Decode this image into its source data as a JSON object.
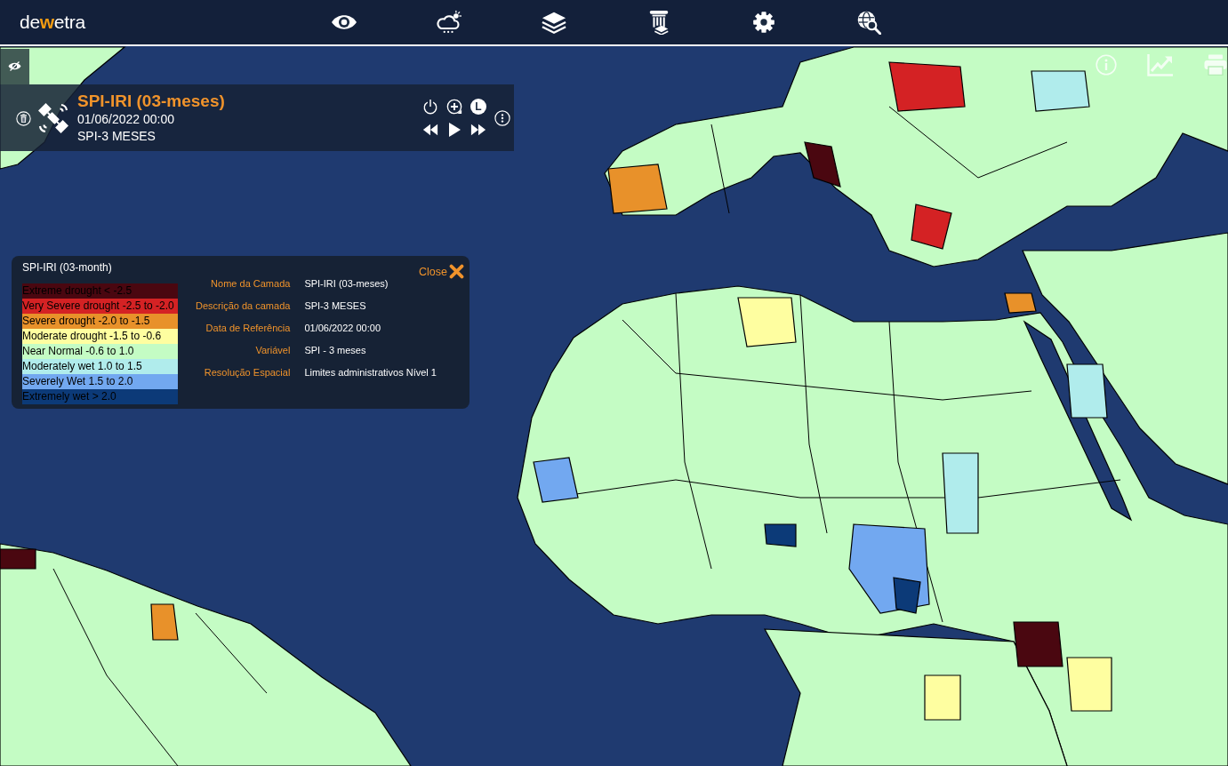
{
  "topbar": {
    "logo": [
      {
        "text": "de",
        "accent": false
      },
      {
        "text": "w",
        "accent": true
      },
      {
        "text": "etra",
        "accent": false
      }
    ]
  },
  "layer": {
    "title": "SPI-IRI (03-meses)",
    "date": "01/06/2022 00:00",
    "description": "SPI-3 MESES",
    "legend_button": "L"
  },
  "legend_popup": {
    "title": "SPI-IRI (03-month)",
    "close": "Close",
    "legend": [
      {
        "label": "Extreme drought < -2.5",
        "color": "#4a0710"
      },
      {
        "label": "Very Severe drought -2.5 to -2.0",
        "color": "#d42224"
      },
      {
        "label": "Severe drought -2.0 to -1.5",
        "color": "#e8912a"
      },
      {
        "label": "Moderate drought -1.5 to -0.6",
        "color": "#fefea0"
      },
      {
        "label": "Near Normal -0.6 to 1.0",
        "color": "#c4fcc4"
      },
      {
        "label": "Moderately wet 1.0 to 1.5",
        "color": "#b0ecec"
      },
      {
        "label": "Severely Wet 1.5 to 2.0",
        "color": "#72a8f0"
      },
      {
        "label": "Extremely wet > 2.0",
        "color": "#0c3a78"
      }
    ],
    "properties": [
      {
        "label": "Nome da Camada",
        "value": "SPI-IRI (03-meses)"
      },
      {
        "label": "Descrição da camada",
        "value": "SPI-3 MESES"
      },
      {
        "label": "Data de Referência",
        "value": "01/06/2022 00:00"
      },
      {
        "label": "Variável",
        "value": "SPI - 3 meses"
      },
      {
        "label": "Resolução Espacial",
        "value": "Limites administrativos Nível 1"
      }
    ]
  }
}
